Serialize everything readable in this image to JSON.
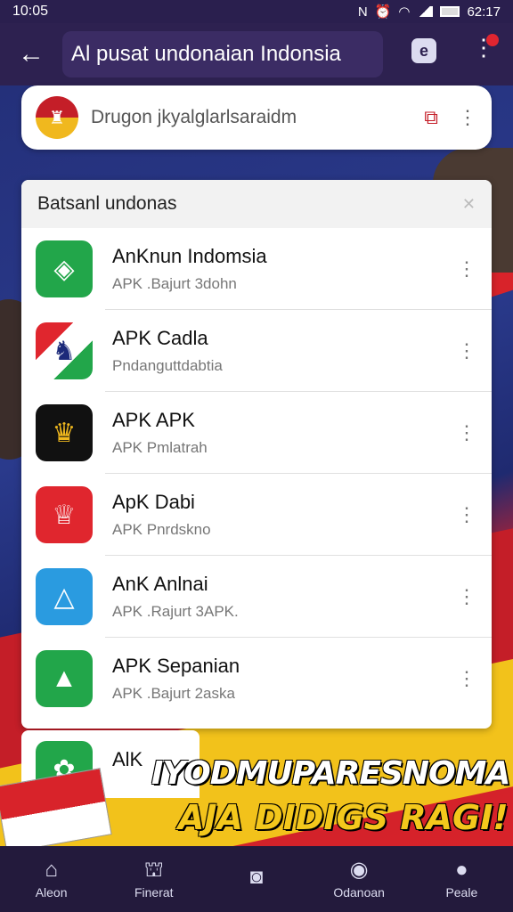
{
  "status_bar": {
    "time": "10:05",
    "icons": [
      "nfc-icon",
      "alarm-icon",
      "wifi-icon",
      "signal-icon",
      "battery-icon"
    ],
    "battery_text": "62:17"
  },
  "app_bar": {
    "back_icon": "arrow-left-icon",
    "title": "Al pusat undonaian Indonsia",
    "action_icon": "e-badge-icon",
    "more_icon": "more-vert-icon"
  },
  "search": {
    "placeholder": "Drugon jkyalglarlsaraidm",
    "logo_icon": "garuda-emblem-icon",
    "camera_icon": "camera-scan-icon",
    "more_icon": "more-vert-icon"
  },
  "list": {
    "header": "Batsanl undonas",
    "close_icon": "close-icon",
    "items": [
      {
        "title": "AnKnun Indomsia",
        "subtitle": "APK .Bajurt 3dohn",
        "icon": "kite-app-icon",
        "color": "#22a64a"
      },
      {
        "title": "APK Cadla",
        "subtitle": "Pndanguttdabtia",
        "icon": "wayang-app-icon",
        "color": "#ffffff"
      },
      {
        "title": "APK APK",
        "subtitle": "APK Pmlatrah",
        "icon": "crown-app-icon",
        "color": "#111111"
      },
      {
        "title": "ApK Dabi",
        "subtitle": "APK Pnrdskno",
        "icon": "crown-red-app-icon",
        "color": "#e0262e"
      },
      {
        "title": "AnK Anlnai",
        "subtitle": "APK .Rajurt 3APK.",
        "icon": "triangle-blue-app-icon",
        "color": "#2a9be0"
      },
      {
        "title": "APK Sepanian",
        "subtitle": "APK .Bajurt 2aska",
        "icon": "triangle-green-app-icon",
        "color": "#22a64a"
      }
    ]
  },
  "partial_item": {
    "title": "AlK",
    "icon": "tree-app-icon",
    "color": "#22a64a"
  },
  "banner": {
    "line1": "IYODMUPARESNOMA",
    "line2": "AJA DIDIGS RAGI!"
  },
  "bottom_nav": [
    {
      "label": "Aleon",
      "icon": "home-icon"
    },
    {
      "label": "Finerat",
      "icon": "bank-icon"
    },
    {
      "label": "",
      "icon": "camera-icon"
    },
    {
      "label": "Odanoan",
      "icon": "chat-icon"
    },
    {
      "label": "Peale",
      "icon": "person-icon"
    }
  ]
}
